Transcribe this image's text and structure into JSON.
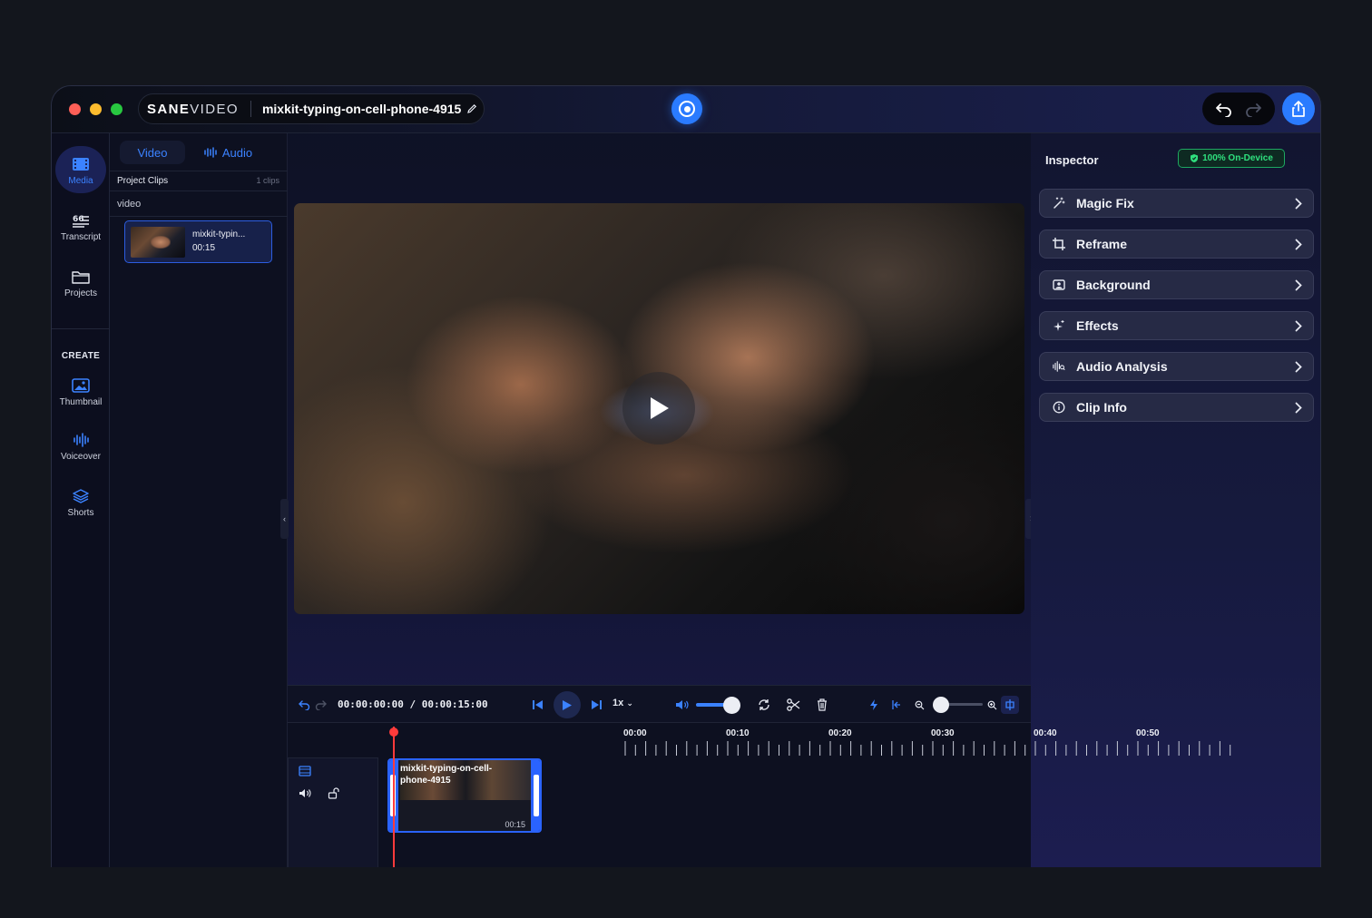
{
  "app": {
    "logo_bold": "SANE",
    "logo_light": "VIDEO",
    "project_name": "mixkit-typing-on-cell-phone-4915"
  },
  "rail": {
    "items": [
      {
        "label": "Media",
        "icon": "film-icon"
      },
      {
        "label": "Transcript",
        "icon": "transcript-icon"
      },
      {
        "label": "Projects",
        "icon": "folder-icon"
      }
    ],
    "create_label": "CREATE",
    "create_items": [
      {
        "label": "Thumbnail",
        "icon": "image-icon"
      },
      {
        "label": "Voiceover",
        "icon": "waveform-icon"
      },
      {
        "label": "Shorts",
        "icon": "layers-icon"
      }
    ]
  },
  "media": {
    "tabs": [
      {
        "label": "Video"
      },
      {
        "label": "Audio"
      }
    ],
    "project_clips_label": "Project Clips",
    "clip_count": "1 clips",
    "section_label": "video",
    "clips": [
      {
        "name": "mixkit-typin...",
        "duration": "00:15"
      }
    ]
  },
  "inspector": {
    "title": "Inspector",
    "badge": "100% On-Device",
    "items": [
      {
        "label": "Magic Fix",
        "icon": "magic-wand-icon"
      },
      {
        "label": "Reframe",
        "icon": "crop-icon"
      },
      {
        "label": "Background",
        "icon": "background-icon"
      },
      {
        "label": "Effects",
        "icon": "sparkle-icon"
      },
      {
        "label": "Audio Analysis",
        "icon": "audio-analysis-icon"
      },
      {
        "label": "Clip Info",
        "icon": "info-icon"
      }
    ]
  },
  "timeline": {
    "timecode": "00:00:00:00 / 00:00:15:00",
    "speed": "1x",
    "volume": 0.85,
    "zoom": 0.1,
    "ruler_labels": [
      "00:00",
      "00:10",
      "00:20",
      "00:30",
      "00:40",
      "00:50"
    ],
    "clip": {
      "name": "mixkit-typing-on-cell-phone-4915",
      "duration": "00:15"
    }
  },
  "colors": {
    "accent": "#2a7bff",
    "badge_green": "#2fe07e",
    "playhead": "#ff3b3b"
  }
}
